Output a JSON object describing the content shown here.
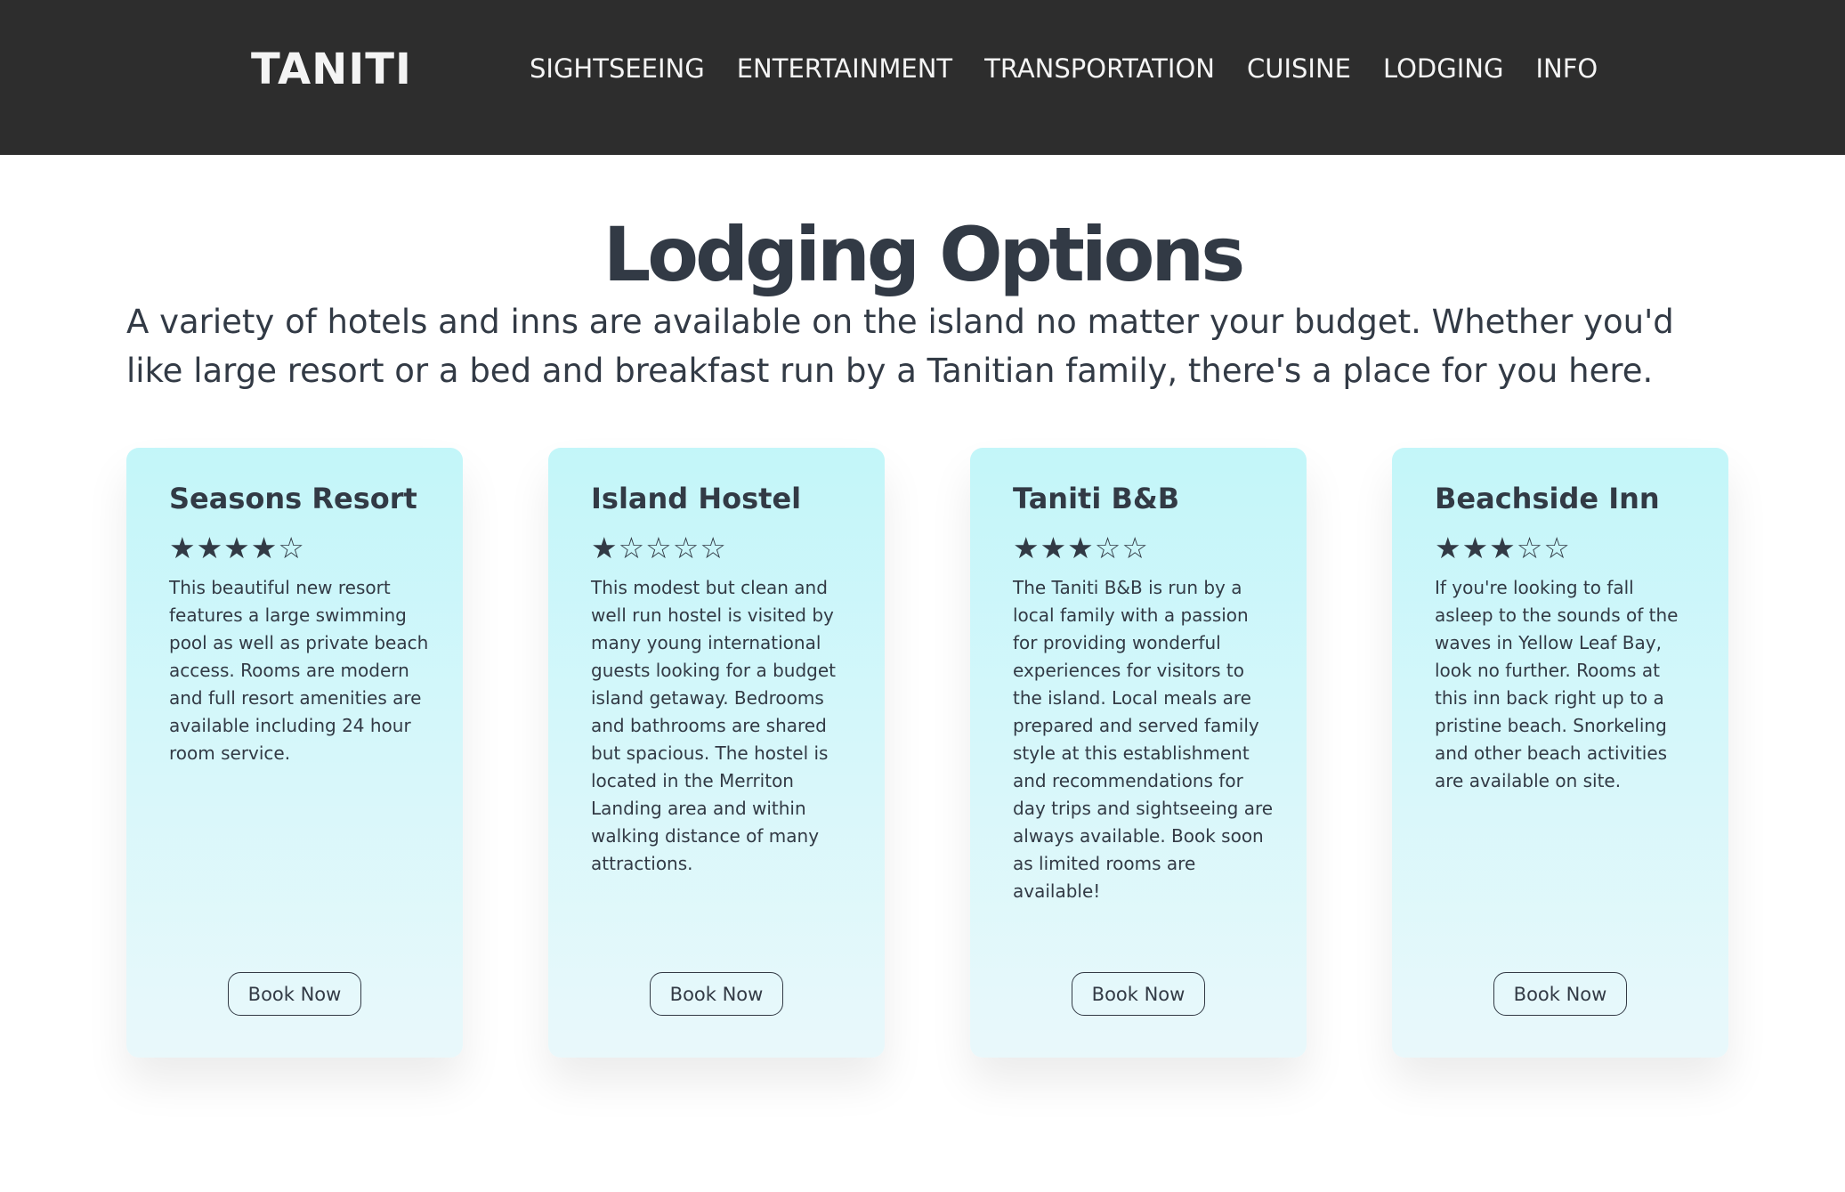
{
  "header": {
    "brand": "TANITI",
    "nav": [
      "SIGHTSEEING",
      "ENTERTAINMENT",
      "TRANSPORTATION",
      "CUISINE",
      "LODGING",
      "INFO"
    ]
  },
  "main": {
    "title": "Lodging Options",
    "intro": "A variety of hotels and inns are available on the island no matter your budget. Whether you'd like large resort or a bed and breakfast run by a Tanitian family, there's a place for you here.",
    "cards": [
      {
        "name": "Seasons Resort",
        "stars": "★★★★☆",
        "rating": 4,
        "description": "This beautiful new resort features a large swimming pool as well as private beach access. Rooms are modern and full resort amenities are available including 24 hour room service.",
        "button": "Book Now"
      },
      {
        "name": "Island Hostel",
        "stars": "★☆☆☆☆",
        "rating": 1,
        "description": "This modest but clean and well run hostel is visited by many young international guests looking for a budget island getaway. Bedrooms and bathrooms are shared but spacious. The hostel is located in the Merriton Landing area and within walking distance of many attractions.",
        "button": "Book Now"
      },
      {
        "name": "Taniti B&B",
        "stars": "★★★☆☆",
        "rating": 3,
        "description": "The Taniti B&B is run by a local family with a passion for providing wonderful experiences for visitors to the island. Local meals are prepared and served family style at this establishment and recommendations for day trips and sightseeing are always available. Book soon as limited rooms are available!",
        "button": "Book Now"
      },
      {
        "name": "Beachside Inn",
        "stars": "★★★☆☆",
        "rating": 3,
        "description": "If you're looking to fall asleep to the sounds of the waves in Yellow Leaf Bay, look no further. Rooms at this inn back right up to a pristine beach. Snorkeling and other beach activities are available on site.",
        "button": "Book Now"
      }
    ]
  },
  "colors": {
    "header_bg": "#2d2d2d",
    "header_text": "#f4f4f4",
    "text": "#323a45",
    "card_gradient_top": "#c3f6f9",
    "card_gradient_bottom": "#e9f8fb"
  }
}
